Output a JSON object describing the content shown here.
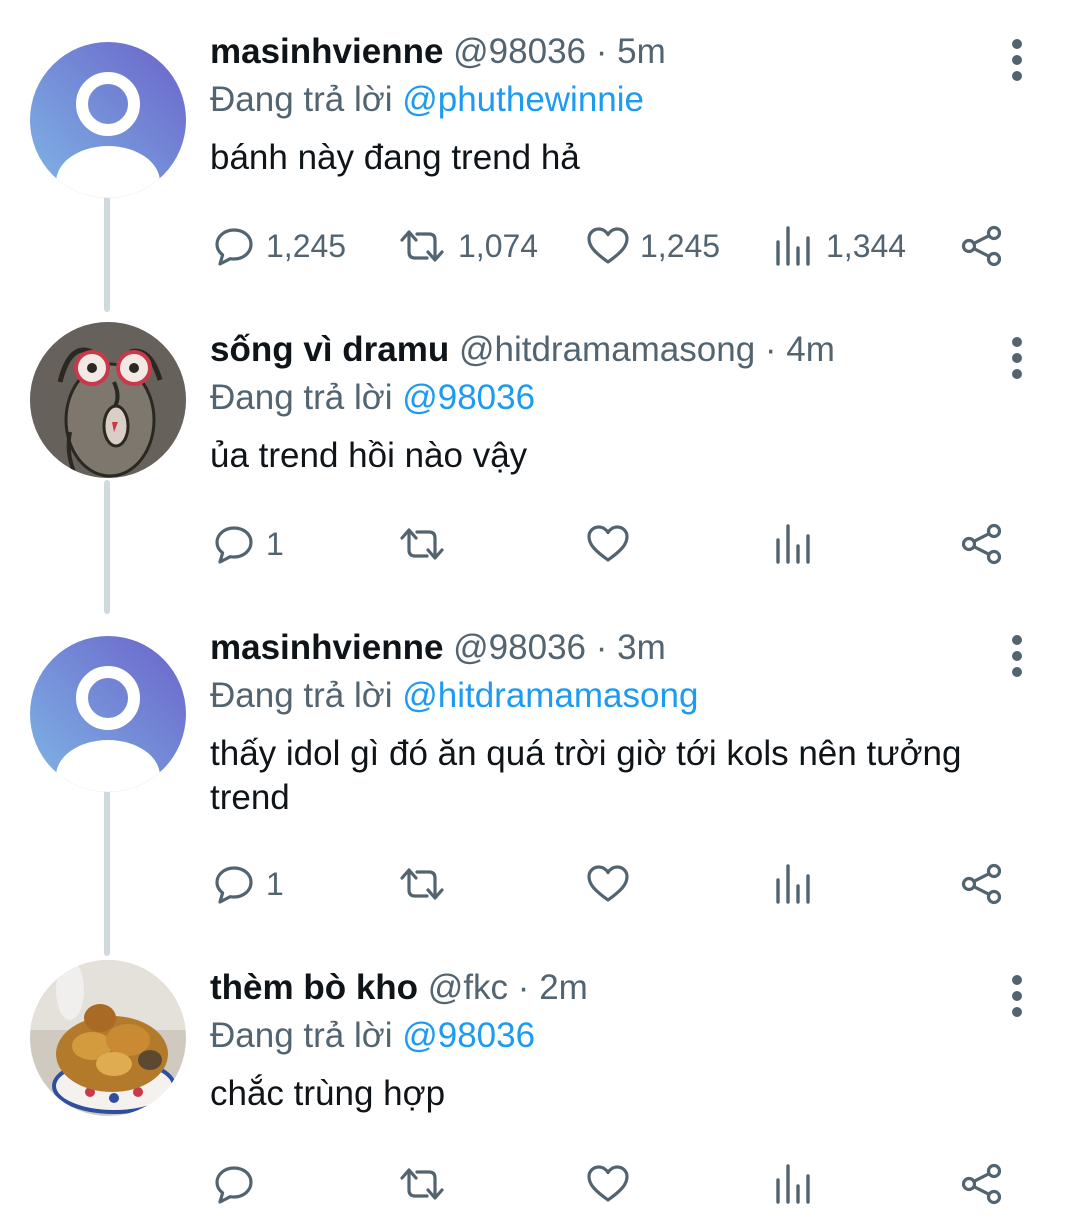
{
  "colors": {
    "accent": "#1d9bf0",
    "muted": "#536471",
    "text": "#0f1419",
    "thread": "#cfd9de"
  },
  "tweets": [
    {
      "name": "masinhvienne",
      "handle": "@98036",
      "dot": "·",
      "time": "5m",
      "reply_prefix": "Đang trả lời",
      "reply_to": "@phuthewinnie",
      "text": "bánh này đang trend hả",
      "avatar": "default-avatar",
      "counts": {
        "reply": "1,245",
        "retweet": "1,074",
        "like": "1,245",
        "views": "1,344"
      }
    },
    {
      "name": "sống vì dramu",
      "handle": "@hitdramamasong",
      "dot": "·",
      "time": "4m",
      "reply_prefix": "Đang trả lời",
      "reply_to": "@98036",
      "text": "ủa trend hồi nào vậy",
      "avatar": "creature-drawing-avatar",
      "counts": {
        "reply": "1",
        "retweet": "",
        "like": "",
        "views": ""
      }
    },
    {
      "name": "masinhvienne",
      "handle": "@98036",
      "dot": "·",
      "time": "3m",
      "reply_prefix": "Đang trả lời",
      "reply_to": "@hitdramamasong",
      "text": "thấy idol gì đó ăn quá trời giờ tới kols nên tưởng trend",
      "avatar": "default-avatar",
      "counts": {
        "reply": "1",
        "retweet": "",
        "like": "",
        "views": ""
      }
    },
    {
      "name": "thèm bò kho",
      "handle": "@fkc",
      "dot": "·",
      "time": "2m",
      "reply_prefix": "Đang trả lời",
      "reply_to": "@98036",
      "text": "chắc trùng hợp",
      "avatar": "food-bowl-avatar",
      "counts": {
        "reply": "",
        "retweet": "",
        "like": "",
        "views": ""
      }
    }
  ],
  "icons": {
    "more": "more-vertical-icon",
    "reply": "reply-bubble-icon",
    "retweet": "retweet-icon",
    "like": "heart-icon",
    "views": "views-chart-icon",
    "share": "share-icon"
  }
}
